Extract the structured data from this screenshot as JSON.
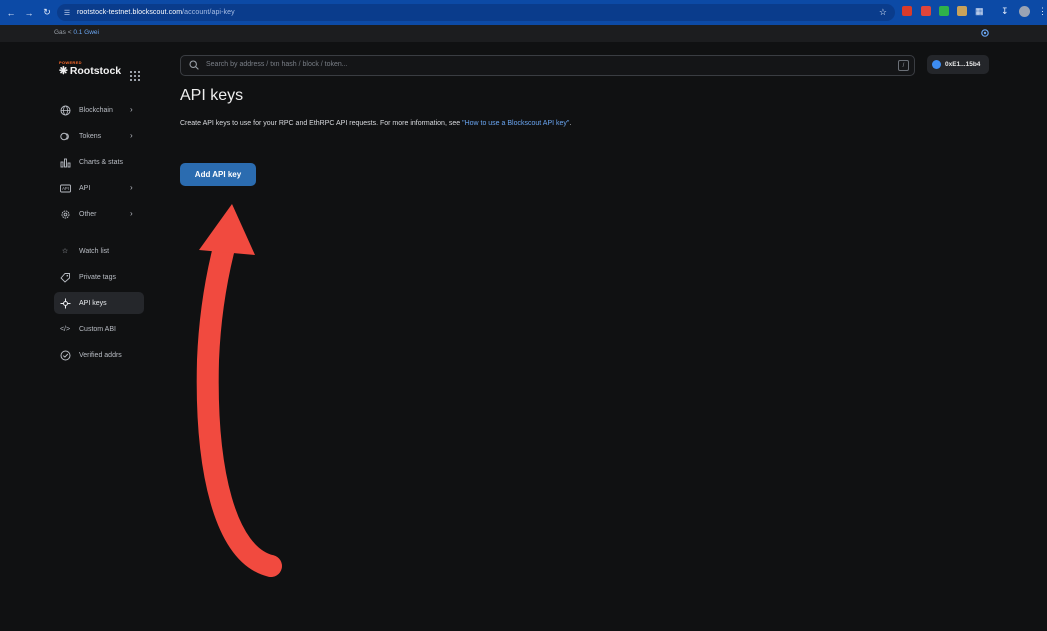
{
  "browser": {
    "url_host": "rootstock-testnet.blockscout.com",
    "url_path": "/account/api-key"
  },
  "topbar": {
    "gas_label": "Gas",
    "gas_value": "0.1 Gwei"
  },
  "sidebar": {
    "brand_tagline": "POWERED",
    "brand_name": "Rootstock",
    "items": [
      {
        "label": "Blockchain",
        "icon": "globe-icon"
      },
      {
        "label": "Tokens",
        "icon": "token-icon"
      },
      {
        "label": "Charts & stats",
        "icon": "chart-icon"
      },
      {
        "label": "API",
        "icon": "api-icon"
      },
      {
        "label": "Other",
        "icon": "gear-icon"
      },
      {
        "label": "Watch list",
        "icon": "star-icon"
      },
      {
        "label": "Private tags",
        "icon": "tag-icon"
      },
      {
        "label": "API keys",
        "icon": "key-icon"
      },
      {
        "label": "Custom ABI",
        "icon": "code-icon"
      },
      {
        "label": "Verified addrs",
        "icon": "check-circle-icon"
      }
    ]
  },
  "search": {
    "placeholder": "Search by address / txn hash / block / token..."
  },
  "wallet": {
    "address": "0xE1...15b4"
  },
  "main": {
    "title": "API keys",
    "desc_prefix": "Create API keys to use for your RPC and EthRPC API requests. For more information, see ",
    "desc_link": "\"How to use a Blockscout API key\"",
    "desc_suffix": ".",
    "add_button": "Add API key"
  },
  "colors": {
    "accent": "#2b6cb0",
    "link": "#6aa6f2",
    "annotation_arrow": "#f14a3f"
  }
}
